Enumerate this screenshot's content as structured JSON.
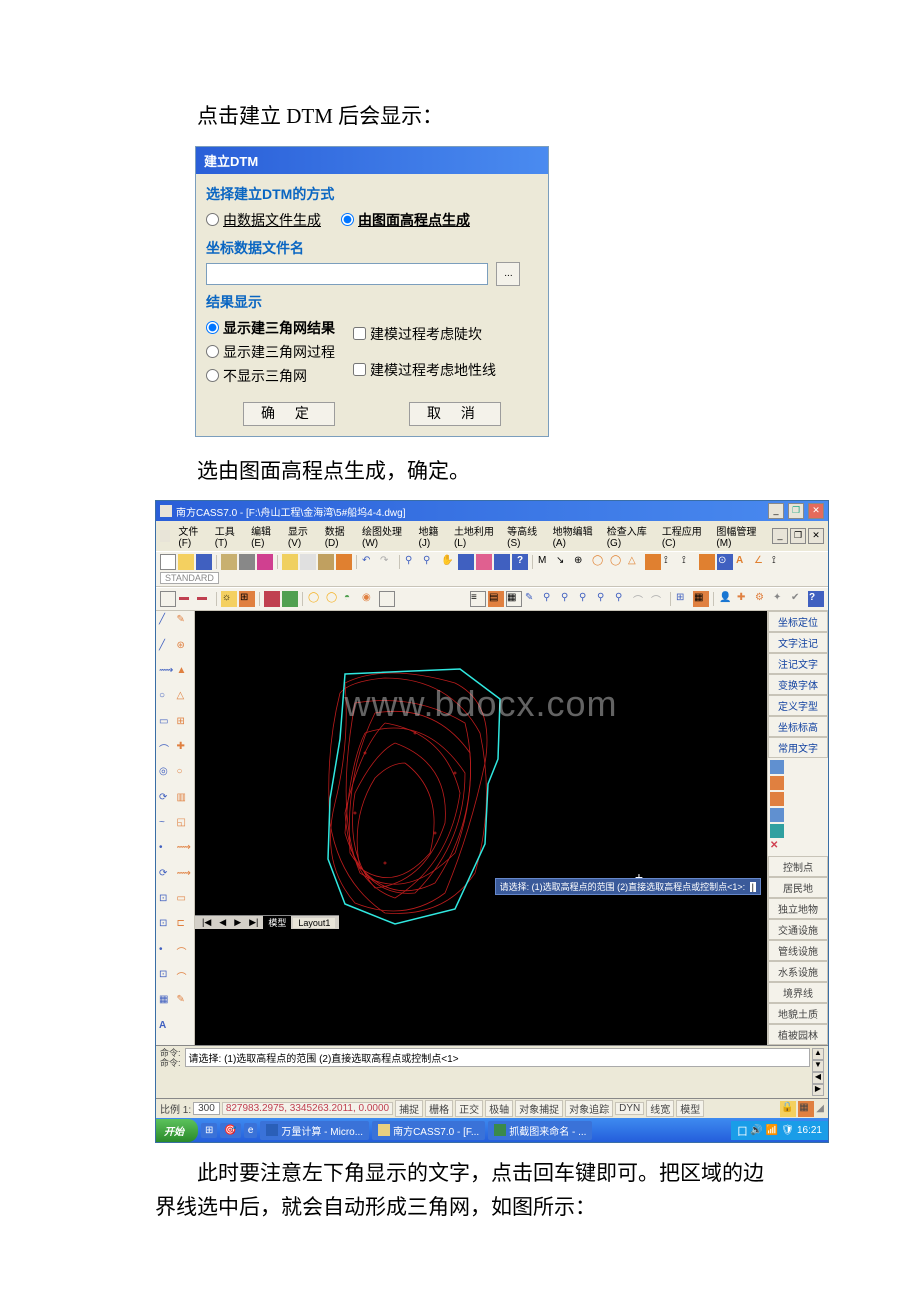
{
  "text": {
    "line1": "点击建立 DTM 后会显示：",
    "line2": "选由图面高程点生成，确定。",
    "line3": "此时要注意左下角显示的文字，点击回车键即可。把区域的边界线选中后，就会自动形成三角网，如图所示："
  },
  "dialog": {
    "title": "建立DTM",
    "group1_label": "选择建立DTM的方式",
    "opt_from_file": "由数据文件生成",
    "opt_from_screen": "由图面高程点生成",
    "group2_label": "坐标数据文件名",
    "browse": "...",
    "group3_label": "结果显示",
    "res_opt1": "显示建三角网结果",
    "res_opt2": "显示建三角网过程",
    "res_opt3": "不显示三角网",
    "chk1": "建模过程考虑陡坎",
    "chk2": "建模过程考虑地性线",
    "ok": "确 定",
    "cancel": "取 消"
  },
  "cass": {
    "title": "南方CASS7.0 - [F:\\舟山工程\\金海湾\\5#船坞4-4.dwg]",
    "menus": [
      "文件(F)",
      "工具(T)",
      "编辑(E)",
      "显示(V)",
      "数据(D)",
      "绘图处理(W)",
      "地籍(J)",
      "土地利用(L)",
      "等高线(S)",
      "地物编辑(A)",
      "检查入库(G)",
      "工程应用(C)",
      "图幅管理(M)"
    ],
    "watermark": "www.bdocx.com",
    "tooltip": "请选择: (1)选取高程点的范围 (2)直接选取高程点或控制点<1>:",
    "tabs_nav": [
      "|◀",
      "◀",
      "▶",
      "▶|"
    ],
    "tabs": [
      "模型",
      "Layout1"
    ],
    "right_top": [
      "坐标定位",
      "文字注记",
      "注记文字",
      "变换字体",
      "定义字型",
      "坐标标高",
      "常用文字"
    ],
    "right_bottom": [
      "控制点",
      "居民地",
      "独立地物",
      "交通设施",
      "管线设施",
      "水系设施",
      "境界线",
      "地貌土质",
      "植被园林"
    ],
    "cmd_label_top": "命令:",
    "cmd_label_bot": "命令:",
    "cmd_line": "请选择: (1)选取高程点的范围 (2)直接选取高程点或控制点<1>",
    "status_scale_label": "比例 1:",
    "status_scale_val": "300",
    "status_coords": "827983.2975, 3345263.2011, 0.0000",
    "status_items": [
      "捕捉",
      "栅格",
      "正交",
      "极轴",
      "对象捕捉",
      "对象追踪",
      "DYN",
      "线宽",
      "模型"
    ],
    "taskbar": {
      "start": "开始",
      "items": [
        "万量计算 - Micro...",
        "南方CASS7.0 - [F...",
        "抓截图来命名 - ..."
      ],
      "time": "16:21"
    },
    "combo_text": "STANDARD"
  }
}
